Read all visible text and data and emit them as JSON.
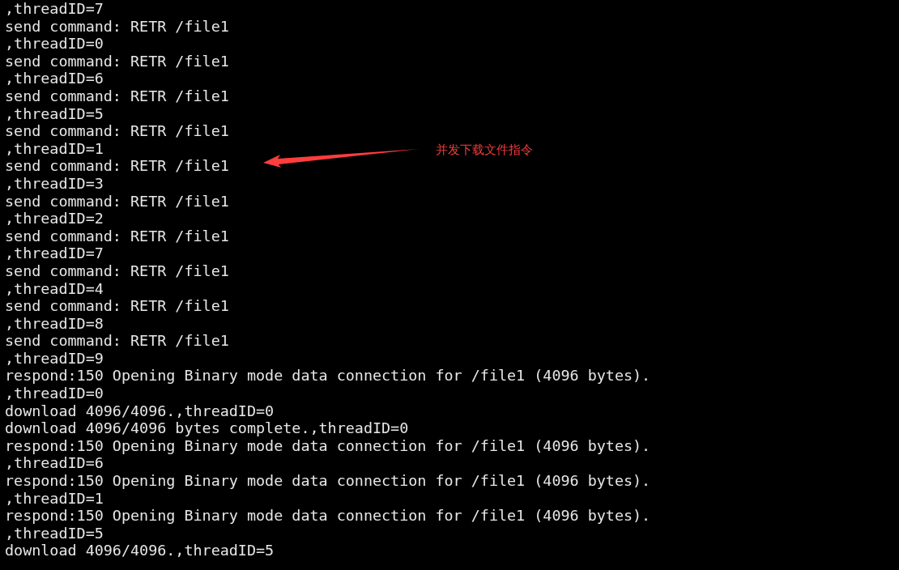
{
  "terminal": {
    "lines": [
      ",threadID=7",
      "send command: RETR /file1",
      ",threadID=0",
      "send command: RETR /file1",
      ",threadID=6",
      "send command: RETR /file1",
      ",threadID=5",
      "send command: RETR /file1",
      ",threadID=1",
      "send command: RETR /file1",
      ",threadID=3",
      "send command: RETR /file1",
      ",threadID=2",
      "send command: RETR /file1",
      ",threadID=7",
      "send command: RETR /file1",
      ",threadID=4",
      "send command: RETR /file1",
      ",threadID=8",
      "send command: RETR /file1",
      ",threadID=9",
      "respond:150 Opening Binary mode data connection for /file1 (4096 bytes).",
      ",threadID=0",
      "download 4096/4096.,threadID=0",
      "download 4096/4096 bytes complete.,threadID=0",
      "respond:150 Opening Binary mode data connection for /file1 (4096 bytes).",
      ",threadID=6",
      "respond:150 Opening Binary mode data connection for /file1 (4096 bytes).",
      ",threadID=1",
      "respond:150 Opening Binary mode data connection for /file1 (4096 bytes).",
      ",threadID=5",
      "download 4096/4096.,threadID=5"
    ]
  },
  "annotation": {
    "text": "并发下载文件指令"
  }
}
